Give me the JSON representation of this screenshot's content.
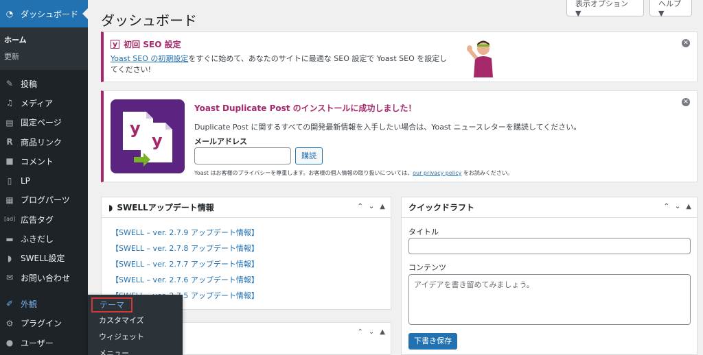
{
  "sidebar": {
    "dashboard_label": "ダッシュボード",
    "sub_items": [
      "ホーム",
      "更新"
    ],
    "items": [
      {
        "label": "投稿",
        "icon": "pin-icon"
      },
      {
        "label": "メディア",
        "icon": "media-icon"
      },
      {
        "label": "固定ページ",
        "icon": "page-icon"
      },
      {
        "label": "商品リンク",
        "icon": "r-icon"
      },
      {
        "label": "コメント",
        "icon": "comment-icon"
      },
      {
        "label": "LP",
        "icon": "lp-icon"
      },
      {
        "label": "ブログパーツ",
        "icon": "blog-parts-icon"
      },
      {
        "label": "広告タグ",
        "icon": "ad-icon"
      },
      {
        "label": "ふきだし",
        "icon": "speech-bubble-icon"
      },
      {
        "label": "SWELL設定",
        "icon": "swell-icon"
      },
      {
        "label": "お問い合わせ",
        "icon": "mail-icon"
      },
      {
        "label": "外観",
        "icon": "appearance-icon"
      },
      {
        "label": "プラグイン",
        "icon": "plugin-icon"
      },
      {
        "label": "ユーザー",
        "icon": "user-icon"
      }
    ]
  },
  "flyout": {
    "items": [
      "テーマ",
      "カスタマイズ",
      "ウィジェット",
      "メニュー"
    ]
  },
  "header": {
    "title": "ダッシュボード",
    "screen_options": "表示オプション ▼",
    "help": "ヘルプ ▼"
  },
  "seo_notice": {
    "title": "初回 SEO 設定",
    "link": "Yoast SEO の初期設定",
    "text": "をすぐに始めて、あなたのサイトに最適な SEO 設定で Yoast SEO を設定してください!"
  },
  "dup_notice": {
    "title": "Yoast Duplicate Post のインストールに成功しました！",
    "body": "Duplicate Post に関するすべての開発最新情報を入手したい場合は、Yoast ニュースレターを購読してください。",
    "email_label": "メールアドレス",
    "subscribe": "購読",
    "privacy_pre": "Yoast はお客様のプライバシーを尊重します。お客様の個人情報の取り扱いについては、",
    "privacy_link": "our privacy policy",
    "privacy_post": " をお読みください。"
  },
  "swell_panel": {
    "title": "SWELLアップデート情報",
    "links": [
      "【SWELL – ver. 2.7.9 アップデート情報】",
      "【SWELL – ver. 2.7.8 アップデート情報】",
      "【SWELL – ver. 2.7.7 アップデート情報】",
      "【SWELL – ver. 2.7.6 アップデート情報】",
      "【SWELL – ver. 2.7.5 アップデート情報】"
    ]
  },
  "quick_draft": {
    "title": "クイックドラフト",
    "title_label": "タイトル",
    "content_label": "コンテンツ",
    "content_placeholder": "アイデアを書き留めてみましょう。",
    "save": "下書き保存"
  },
  "colors": {
    "accent": "#2271b1",
    "yoast": "#a4286a",
    "sidebar": "#1d2327"
  }
}
